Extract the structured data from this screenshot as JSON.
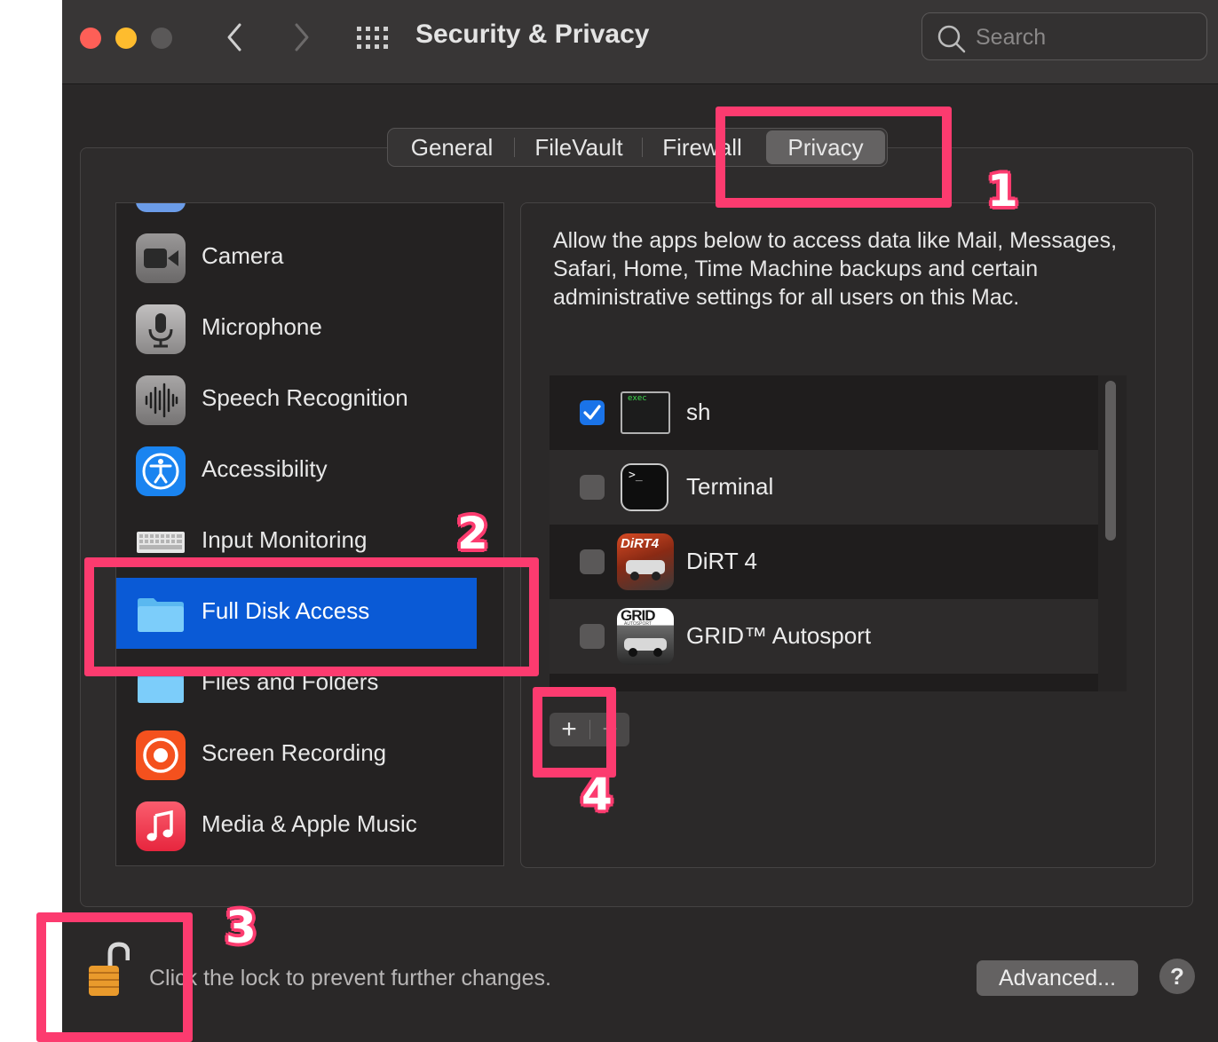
{
  "window": {
    "title": "Security & Privacy",
    "search_placeholder": "Search"
  },
  "tabs": [
    "General",
    "FileVault",
    "Firewall",
    "Privacy"
  ],
  "selected_tab": "Privacy",
  "sidebar": {
    "items": [
      {
        "label": "Camera",
        "icon": "camera-icon"
      },
      {
        "label": "Microphone",
        "icon": "microphone-icon"
      },
      {
        "label": "Speech Recognition",
        "icon": "waveform-icon"
      },
      {
        "label": "Accessibility",
        "icon": "accessibility-icon"
      },
      {
        "label": "Input Monitoring",
        "icon": "keyboard-icon"
      },
      {
        "label": "Full Disk Access",
        "icon": "folder-icon",
        "selected": true
      },
      {
        "label": "Files and Folders",
        "icon": "folder-icon"
      },
      {
        "label": "Screen Recording",
        "icon": "record-icon"
      },
      {
        "label": "Media & Apple Music",
        "icon": "music-note-icon"
      }
    ]
  },
  "main": {
    "description": "Allow the apps below to access data like Mail, Messages, Safari, Home, Time Machine backups and certain administrative settings for all users on this Mac.",
    "apps": [
      {
        "name": "sh",
        "checked": true,
        "icon": "exec-icon",
        "icon_text": "exec"
      },
      {
        "name": "Terminal",
        "checked": false,
        "icon": "terminal-icon",
        "icon_text": ">_"
      },
      {
        "name": "DiRT 4",
        "checked": false,
        "icon": "dirt4-app-icon",
        "icon_text": "DiRT4"
      },
      {
        "name": "GRID™ Autosport",
        "checked": false,
        "icon": "grid-autosport-app-icon",
        "icon_text": "GRID",
        "icon_subtext": "AUTOSPORT"
      }
    ],
    "add_label": "+",
    "remove_label": "−"
  },
  "footer": {
    "lock_text": "Click the lock to prevent further changes.",
    "advanced_label": "Advanced...",
    "help_label": "?"
  },
  "annotations": [
    "1",
    "2",
    "3",
    "4"
  ],
  "colors": {
    "annotation": "#fc3b6f",
    "selection": "#0a5ad6",
    "checkbox_on": "#1a73e8",
    "window_bg": "#2a2828"
  }
}
